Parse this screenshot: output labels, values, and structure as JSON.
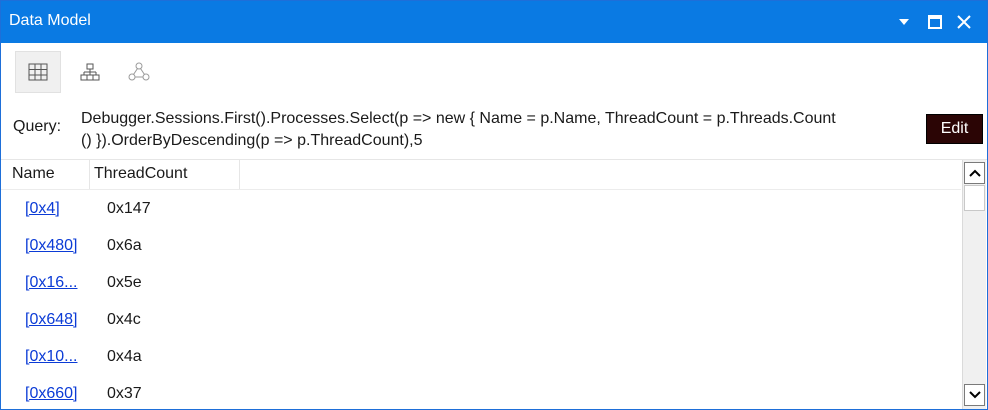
{
  "window": {
    "title": "Data Model",
    "accent_color": "#0a7ae3",
    "controls": [
      "dropdown-icon",
      "maximize-icon",
      "close-icon"
    ]
  },
  "toolbar": {
    "views": [
      {
        "name": "grid-view",
        "icon": "grid-icon",
        "active": true
      },
      {
        "name": "hierarchy-view",
        "icon": "hierarchy-icon",
        "active": false
      },
      {
        "name": "graph-view",
        "icon": "graph-icon",
        "active": false
      }
    ]
  },
  "query": {
    "label": "Query:",
    "line1": "Debugger.Sessions.First().Processes.Select(p => new { Name = p.Name, ThreadCount = p.Threads.Count",
    "line2": "() }).OrderByDescending(p => p.ThreadCount),5",
    "edit_label": "Edit"
  },
  "grid": {
    "columns": [
      "Name",
      "ThreadCount"
    ],
    "rows": [
      {
        "name": "[0x4]",
        "thread_count": "0x147"
      },
      {
        "name": "[0x480]",
        "thread_count": "0x6a"
      },
      {
        "name": "[0x16...",
        "thread_count": "0x5e"
      },
      {
        "name": "[0x648]",
        "thread_count": "0x4c"
      },
      {
        "name": "[0x10...",
        "thread_count": "0x4a"
      },
      {
        "name": "[0x660]",
        "thread_count": "0x37"
      }
    ]
  }
}
